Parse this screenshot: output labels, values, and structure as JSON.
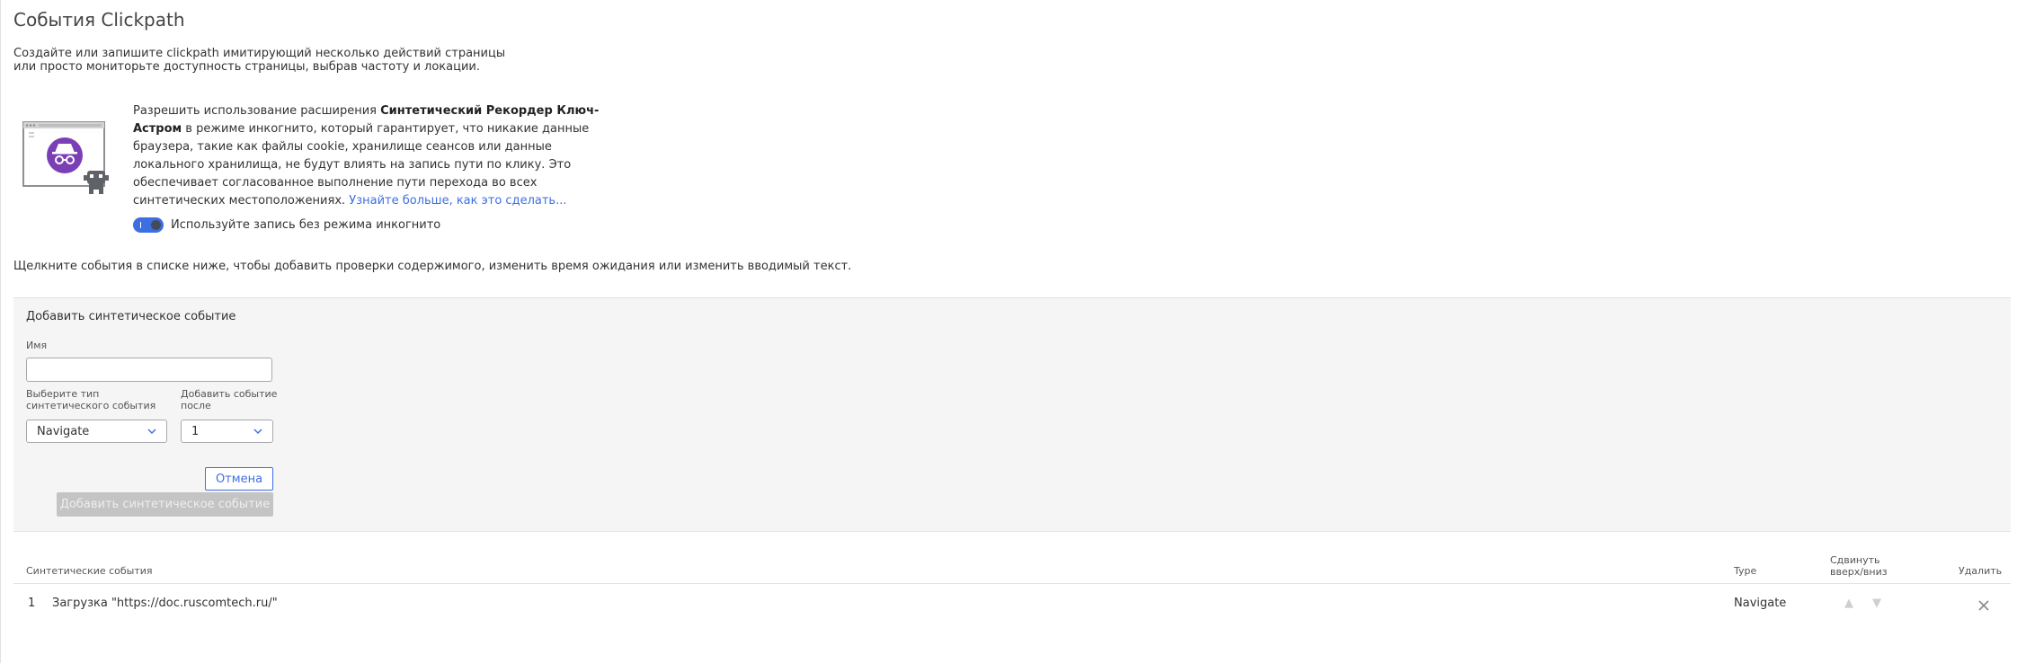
{
  "page": {
    "title": "События Clickpath",
    "intro": "Создайте или запишите clickpath имитирующий несколько действий страницы или просто мониторьте доступность страницы, выбрав частоту и локации.",
    "hint": "Щелкните события в списке ниже, чтобы добавить проверки содержимого, изменить время ожидания или изменить вводимый текст."
  },
  "extension": {
    "text_before": "Разрешить использование расширения ",
    "product": "Синтетический Рекордер Ключ-Астром",
    "text_after": " в режиме инкогнито, который гарантирует, что никакие данные браузера, такие как файлы cookie, хранилище сеансов или данные локального хранилища, не будут влиять на запись пути по клику. Это обеспечивает согласованное выполнение пути перехода во всех синтетических местоположениях. ",
    "link": "Узнайте больше, как это сделать...",
    "toggle_label": "Используйте запись без режима инкогнито",
    "toggle_on": true,
    "illustration_icon": "incognito-robot-icon"
  },
  "form": {
    "title": "Добавить синтетическое событие",
    "name_label": "Имя",
    "name_value": "",
    "type_label": "Выберите тип синтетического события",
    "type_value": "Navigate",
    "after_label": "Добавить событие после",
    "after_value": "1",
    "cancel_label": "Отмена",
    "add_label": "Добавить синтетическое событие"
  },
  "table": {
    "col_events": "Синтетические события",
    "col_type": "Type",
    "col_move": "Сдвинуть вверх/вниз",
    "col_delete": "Удалить",
    "rows": [
      {
        "index": "1",
        "name": "Загрузка \"https://doc.ruscomtech.ru/\"",
        "type": "Navigate"
      }
    ]
  },
  "colors": {
    "accent": "#3d6fe3",
    "incognito_purple": "#7b3fb5",
    "disabled_button": "#c4c4c4",
    "panel_bg": "#f5f5f5"
  }
}
